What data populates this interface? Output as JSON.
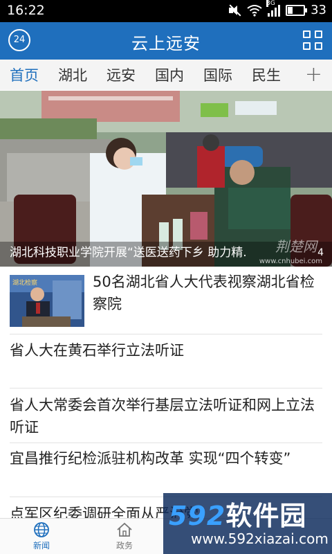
{
  "status": {
    "time": "16:22",
    "network": "3G",
    "battery": "33",
    "battery_level": 0.33
  },
  "header": {
    "title": "云上远安",
    "weather_badge": "24"
  },
  "tabs": [
    "首页",
    "湖北",
    "远安",
    "国内",
    "国际",
    "民生"
  ],
  "tabs_more": "+",
  "banner": {
    "caption": "湖北科技职业学院开展“送医送药下乡 助力精.",
    "index": "4",
    "watermark_url": "www.cnhubei.com",
    "watermark_logo": "荆楚网"
  },
  "news": [
    {
      "title": "50名湖北省人大代表视察湖北省检察院",
      "thumb_text": "湖北检察"
    },
    {
      "title": "省人大在黄石举行立法听证"
    },
    {
      "title": "省人大常委会首次举行基层立法听证和网上立法听证"
    },
    {
      "title": "宜昌推行纪检派驻机构改革 实现“四个转变”"
    },
    {
      "title": "点军区纪委调研全面从严治党"
    }
  ],
  "bottom_nav": [
    {
      "label": "新闻",
      "icon": "globe-icon",
      "active": true
    },
    {
      "label": "政务",
      "icon": "home-icon",
      "active": false
    }
  ],
  "overlay_watermark": {
    "digits": "592",
    "text": "软件园",
    "url": "www.592xiazai.com"
  },
  "colors": {
    "brand_blue": "#1f6fbd",
    "status_bar": "#000000",
    "tab_bg": "#f4f4f4"
  }
}
